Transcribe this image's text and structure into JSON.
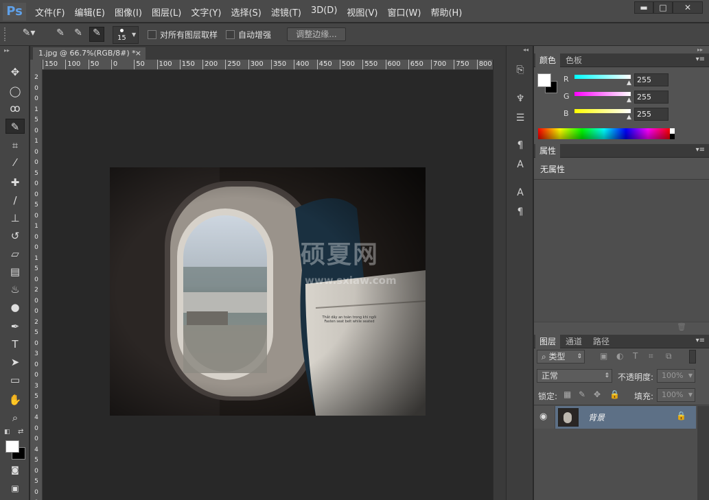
{
  "app": {
    "logo": "Ps"
  },
  "menu": [
    "文件(F)",
    "编辑(E)",
    "图像(I)",
    "图层(L)",
    "文字(Y)",
    "选择(S)",
    "滤镜(T)",
    "3D(D)",
    "视图(V)",
    "窗口(W)",
    "帮助(H)"
  ],
  "window_controls": {
    "minimize": "▬",
    "restore": "□",
    "close": "✕"
  },
  "options": {
    "brush_size": "15",
    "sample_all_layers": "对所有图层取样",
    "auto_enhance": "自动增强",
    "refine_edge": "调整边缘..."
  },
  "document": {
    "tab_title": "1.jpg @ 66.7%(RGB/8#) *",
    "tab_close": "×"
  },
  "ruler": {
    "h": [
      "150",
      "100",
      "50",
      "0",
      "50",
      "100",
      "150",
      "200",
      "250",
      "300",
      "350",
      "400",
      "450",
      "500",
      "550",
      "600",
      "650",
      "700",
      "750",
      "800"
    ],
    "v": [
      "2",
      "0",
      "0",
      "1",
      "5",
      "0",
      "1",
      "0",
      "0",
      "5",
      "0",
      "0",
      "5",
      "0",
      "1",
      "0",
      "0",
      "1",
      "5",
      "0",
      "2",
      "0",
      "0",
      "2",
      "5",
      "0",
      "3",
      "0",
      "0",
      "3",
      "5",
      "0",
      "4",
      "0",
      "0",
      "4",
      "5",
      "0",
      "5",
      "0",
      "0"
    ]
  },
  "watermark": {
    "title": "硕夏网",
    "url": "www.sxiaw.com"
  },
  "photo": {
    "caption": "Thắt dây an toàn trong khi ngồi\nFasten seat belt while seated"
  },
  "panels": {
    "color": {
      "tabs": [
        "颜色",
        "色板"
      ],
      "channels": [
        {
          "label": "R",
          "value": "255"
        },
        {
          "label": "G",
          "value": "255"
        },
        {
          "label": "B",
          "value": "255"
        }
      ]
    },
    "properties": {
      "tab": "属性",
      "text": "无属性"
    },
    "layers": {
      "tabs": [
        "图层",
        "通道",
        "路径"
      ],
      "filter": "类型",
      "blend": "正常",
      "opacity_label": "不透明度:",
      "opacity": "100%",
      "lock_label": "锁定:",
      "fill_label": "填充:",
      "fill": "100%",
      "layer_name": "背景"
    }
  }
}
